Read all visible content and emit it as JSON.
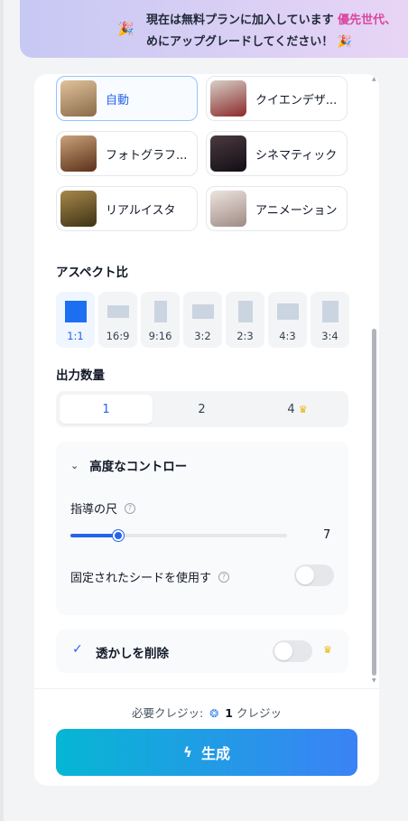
{
  "banner": {
    "text_before": "現在は無料プランに加入しています",
    "text_highlight": "優先世代、",
    "text_line2": "めにアップグレードしてください！"
  },
  "styles": [
    {
      "label": "自動",
      "selected": true,
      "thumb_color": "#b98a5c"
    },
    {
      "label": "クイエンデザ...",
      "selected": false,
      "thumb_color": "#7c6f6a"
    },
    {
      "label": "フォトグラフ...",
      "selected": false,
      "thumb_color": "#8a5a38"
    },
    {
      "label": "シネマティック",
      "selected": false,
      "thumb_color": "#2a2430"
    },
    {
      "label": "リアルイスタ",
      "selected": false,
      "thumb_color": "#6b5a2e"
    },
    {
      "label": "アニメーション",
      "selected": false,
      "thumb_color": "#c9b8b2"
    }
  ],
  "aspect": {
    "title": "アスペクト比",
    "options": [
      {
        "label": "1:1",
        "selected": true
      },
      {
        "label": "16:9",
        "selected": false
      },
      {
        "label": "9:16",
        "selected": false
      },
      {
        "label": "3:2",
        "selected": false
      },
      {
        "label": "2:3",
        "selected": false
      },
      {
        "label": "4:3",
        "selected": false
      },
      {
        "label": "3:4",
        "selected": false
      }
    ]
  },
  "output_count": {
    "title": "出力数量",
    "options": [
      {
        "label": "1",
        "selected": true
      },
      {
        "label": "2",
        "selected": false
      },
      {
        "label": "4",
        "selected": false,
        "premium": true
      }
    ]
  },
  "advanced": {
    "title": "高度なコントロー",
    "guidance_label": "指導の尺",
    "guidance_value": "7",
    "guidance_fraction": 0.22,
    "seed_label": "固定されたシードを使用す",
    "seed_enabled": false
  },
  "watermark": {
    "label": "透かしを削除",
    "enabled": false,
    "premium": true
  },
  "footer": {
    "credits_prefix": "必要クレジッ:",
    "credits_amount": "1",
    "credits_suffix": "クレジッ",
    "generate_label": "生成"
  },
  "colors": {
    "accent": "#2563eb",
    "gradient_start": "#06b6d4",
    "gradient_end": "#3b82f6",
    "highlight": "#d946a0"
  }
}
